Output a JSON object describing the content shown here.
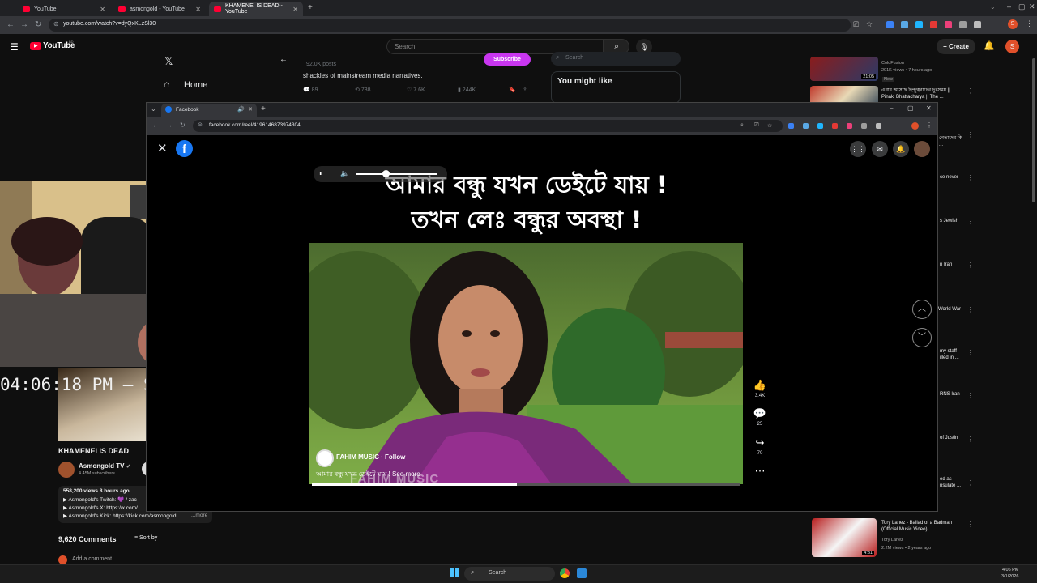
{
  "browser": {
    "tabs": [
      {
        "title": "YouTube"
      },
      {
        "title": "asmongold - YouTube"
      },
      {
        "title": "KHAMENEI IS DEAD - YouTube"
      }
    ],
    "new_tab": "+",
    "url": "youtube.com/watch?v=dyQxKLzSl30",
    "window_controls": [
      "–",
      "▢",
      "✕"
    ]
  },
  "youtube": {
    "logo": "YouTube",
    "logo_sup": "BD",
    "search_placeholder": "Search",
    "create_label": "Create",
    "avatar_letter": "S",
    "video_title": "KHAMENEI IS DEAD",
    "channel_name": "Asmongold TV",
    "channel_subs": "4.45M subscribers",
    "description": {
      "views_line": "558,200 views  8 hours ago",
      "lines": [
        "▶ Asmongold's Twitch: 💜 / zac",
        "▶ Asmongold's X: https://x.com/",
        "▶ Asmongold's Kick: https://kick.com/asmongold"
      ],
      "more": "...more"
    },
    "comments_count": "9,620 Comments",
    "sort_by": "Sort by",
    "add_comment": "Add a comment...",
    "recommendations": [
      {
        "title": "",
        "channel": "ColdFusion",
        "meta": "201K views • 7 hours ago",
        "badge": "New",
        "duration": "21:05"
      },
      {
        "title": "এবার আসছে হিন্দুত্ববাদের দুঃসময় || Pinaki Bhattacharya || The ...",
        "channel": "",
        "meta": "",
        "badge": "",
        "duration": ""
      },
      {
        "title": "নেতাদের কি ...",
        "channel": "",
        "meta": "",
        "badge": "",
        "duration": ""
      },
      {
        "title": "ce never",
        "channel": "",
        "meta": "",
        "badge": "",
        "duration": ""
      },
      {
        "title": "s Jewish",
        "channel": "",
        "meta": "",
        "badge": "",
        "duration": ""
      },
      {
        "title": "n Iran",
        "channel": "",
        "meta": "",
        "badge": "",
        "duration": ""
      },
      {
        "title": "World War",
        "channel": "",
        "meta": "",
        "badge": "",
        "duration": ""
      },
      {
        "title": "my staff illed in ...",
        "channel": "",
        "meta": "",
        "badge": "",
        "duration": ""
      },
      {
        "title": "RNS Iran",
        "channel": "",
        "meta": "",
        "badge": "",
        "duration": ""
      },
      {
        "title": "of Justin",
        "channel": "",
        "meta": "",
        "badge": "",
        "duration": ""
      },
      {
        "title": "ed as nsulate ...",
        "channel": "",
        "meta": "",
        "badge": "",
        "duration": ""
      },
      {
        "title": "Tory Lanez - Ballad of a Badman (Official Music Video)",
        "channel": "Tory Lanez",
        "meta": "2.2M views • 2 years ago",
        "badge": "",
        "duration": "4:31"
      }
    ]
  },
  "x_embed": {
    "home_label": "Home",
    "posts_count": "92.0K posts",
    "tweet_text": "shackles of mainstream media narratives.",
    "subscribe_label": "Subscribe",
    "search_placeholder": "Search",
    "you_might_like": "You might like",
    "stats": [
      "89",
      "738",
      "7.6K",
      "244K"
    ]
  },
  "stream_overlay": {
    "clock": "04:06:18 PM – Sunday"
  },
  "facebook_window": {
    "tab_title": "Facebook",
    "url": "facebook.com/reel/4196146873974304",
    "caption_line1": "আমার বন্ধু যখন ডেইটে যায় !",
    "caption_line2": "তখন লেঃ বন্ধুর অবস্থা !",
    "author": "FAHIM MUSIC",
    "follow": "Follow",
    "reel_caption": "আমার বন্ধু যখন ডেইটে যায় !",
    "see_more": "See more",
    "watermark": "FAHIM MUSIC",
    "likes": "3.4K",
    "comments": "25",
    "shares": "70",
    "progress": 0.48
  },
  "taskbar": {
    "search_label": "Search",
    "time": "4:06 PM",
    "date": "3/1/2026"
  }
}
